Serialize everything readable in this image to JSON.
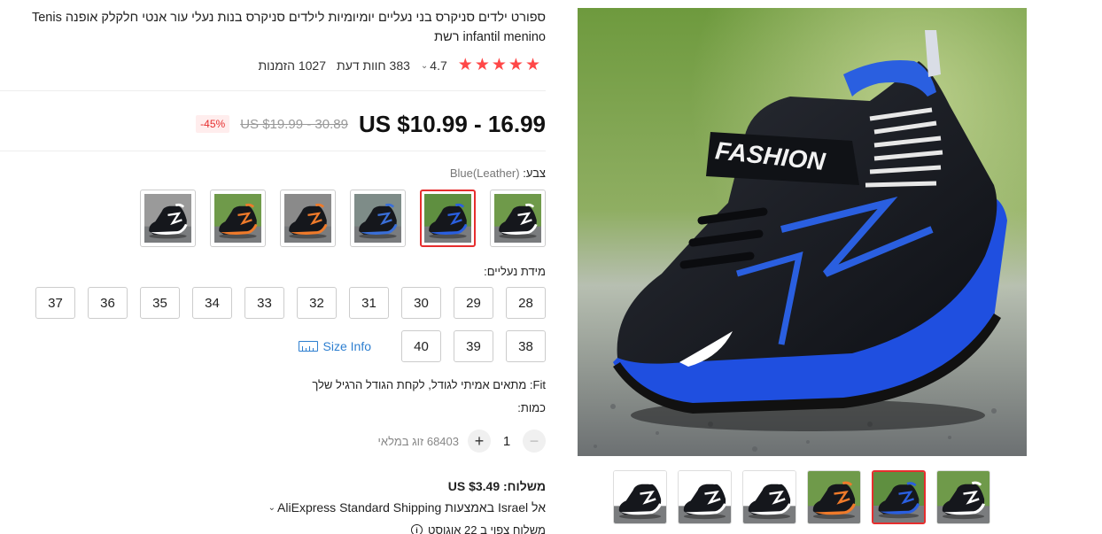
{
  "product": {
    "title": "ספורט ילדים סניקרס בני נעליים יומיומיות לילדים סניקרס בנות נעלי עור אנטי חלקלק אופנה Tenis infantil menino רשת",
    "rating": "4.7",
    "reviews": "383 חוות דעת",
    "orders": "1027 הזמנות",
    "stars": 5
  },
  "price": {
    "current": "US $10.99 - 16.99",
    "original": "US $19.99 - 30.89",
    "discount": "-45%"
  },
  "color": {
    "label": "צבע:",
    "selected": "Blue(Leather)",
    "swatches": [
      {
        "name": "white-black",
        "accent": "#ffffff",
        "bg": "#6f9a4a"
      },
      {
        "name": "blue-black",
        "accent": "#2a5fe0",
        "bg": "#5f8f40"
      },
      {
        "name": "blue-dark",
        "accent": "#3a6fd8",
        "bg": "#7e8c88"
      },
      {
        "name": "orange-dark",
        "accent": "#ef7a2a",
        "bg": "#8a8a8a"
      },
      {
        "name": "orange-black",
        "accent": "#ef7a2a",
        "bg": "#6f9a4a"
      },
      {
        "name": "white-dark",
        "accent": "#ffffff",
        "bg": "#9a9a9a"
      }
    ],
    "selected_index": 1
  },
  "size": {
    "label": "מידת נעליים:",
    "row1": [
      "28",
      "29",
      "30",
      "31",
      "32",
      "33",
      "34",
      "35",
      "36",
      "37"
    ],
    "row2": [
      "38",
      "39",
      "40"
    ],
    "size_info": "Size Info"
  },
  "fit": "Fit: מתאים אמיתי לגודל, לקחת הגודל הרגיל שלך",
  "quantity": {
    "label": "כמות:",
    "value": "1",
    "available": "68403 זוג במלאי",
    "minus": "−",
    "plus": "+"
  },
  "shipping": {
    "price": "משלוח: US $3.49",
    "method": "אל Israel באמצעות AliExpress Standard Shipping",
    "delivery": "משלוח צפוי ב 22 אוגוסט"
  },
  "gallery": {
    "main_alt": "FASHION",
    "thumbs": [
      {
        "name": "sole-view"
      },
      {
        "name": "side-view"
      },
      {
        "name": "pair-view"
      },
      {
        "name": "orange-view"
      },
      {
        "name": "blue-view"
      },
      {
        "name": "white-view"
      }
    ],
    "selected_index": 4
  },
  "colors": {
    "accent_red": "#e62e2e",
    "star_red": "#ff4747",
    "link_blue": "#2e7fd0",
    "shoe_blue": "#1f4fe0"
  }
}
